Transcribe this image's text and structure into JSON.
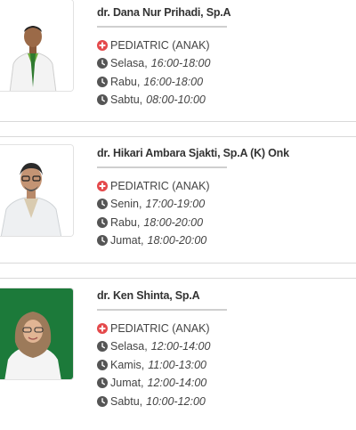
{
  "doctors": [
    {
      "name": "dr. Dana Nur Prihadi, Sp.A",
      "specialty": "PEDIATRIC (ANAK)",
      "schedule": [
        {
          "day": "Selasa,",
          "time": "16:00-18:00"
        },
        {
          "day": "Rabu,",
          "time": "16:00-18:00"
        },
        {
          "day": "Sabtu,",
          "time": "08:00-10:00"
        }
      ]
    },
    {
      "name": "dr. Hikari Ambara Sjakti, Sp.A (K) Onk",
      "specialty": "PEDIATRIC (ANAK)",
      "schedule": [
        {
          "day": "Senin,",
          "time": "17:00-19:00"
        },
        {
          "day": "Rabu,",
          "time": "18:00-20:00"
        },
        {
          "day": "Jumat,",
          "time": "18:00-20:00"
        }
      ]
    },
    {
      "name": "dr. Ken Shinta, Sp.A",
      "specialty": "PEDIATRIC (ANAK)",
      "schedule": [
        {
          "day": "Selasa,",
          "time": "12:00-14:00"
        },
        {
          "day": "Kamis,",
          "time": "11:00-13:00"
        },
        {
          "day": "Jumat,",
          "time": "12:00-14:00"
        },
        {
          "day": "Sabtu,",
          "time": "10:00-12:00"
        }
      ]
    }
  ],
  "colors": {
    "specialty_icon": "#e4494b",
    "clock_icon": "#555555",
    "photo3_background": "#1c7a3a"
  },
  "icons": {
    "specialty": "medical-cross-icon",
    "schedule": "clock-icon"
  }
}
